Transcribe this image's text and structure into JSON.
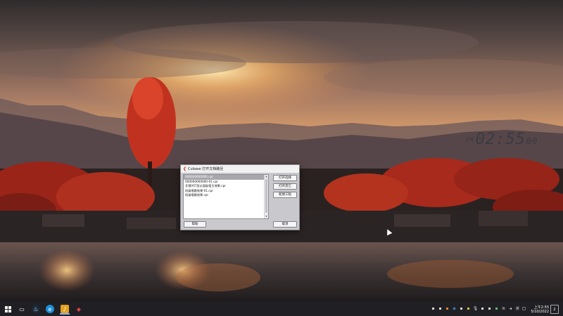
{
  "desktop": {
    "clock": {
      "prefix": "PM",
      "time": "02:55",
      "seconds": "00"
    }
  },
  "dialog": {
    "app_icon": "cubase-icon",
    "title": "Cubase 打开文档路径",
    "files": [
      "000000000000.cpr",
      "000000000000-01.cpr",
      "艾薇VST显示面板宿主效果.cpr",
      "机架唱歌效果-01.cpr",
      "机架唱歌效果.cpr"
    ],
    "selected_index": 0,
    "buttons": {
      "open_selected": "打开选择",
      "open_other": "打开其它",
      "new_project": "新建工程",
      "help": "帮助",
      "cancel": "取消"
    }
  },
  "taskbar": {
    "start_icon": "windows-start-icon",
    "pinned": [
      {
        "name": "task-view-icon",
        "glyph": "▭"
      },
      {
        "name": "steam-icon",
        "glyph": "♨"
      },
      {
        "name": "edge-icon",
        "glyph": "e"
      },
      {
        "name": "cubase-taskbar-icon",
        "glyph": "♪"
      },
      {
        "name": "app-icon",
        "glyph": "◆"
      }
    ],
    "tray": {
      "ime_label": "拼",
      "time": "上午2:55",
      "date": "5/10/2022",
      "notification_count": "2"
    }
  }
}
